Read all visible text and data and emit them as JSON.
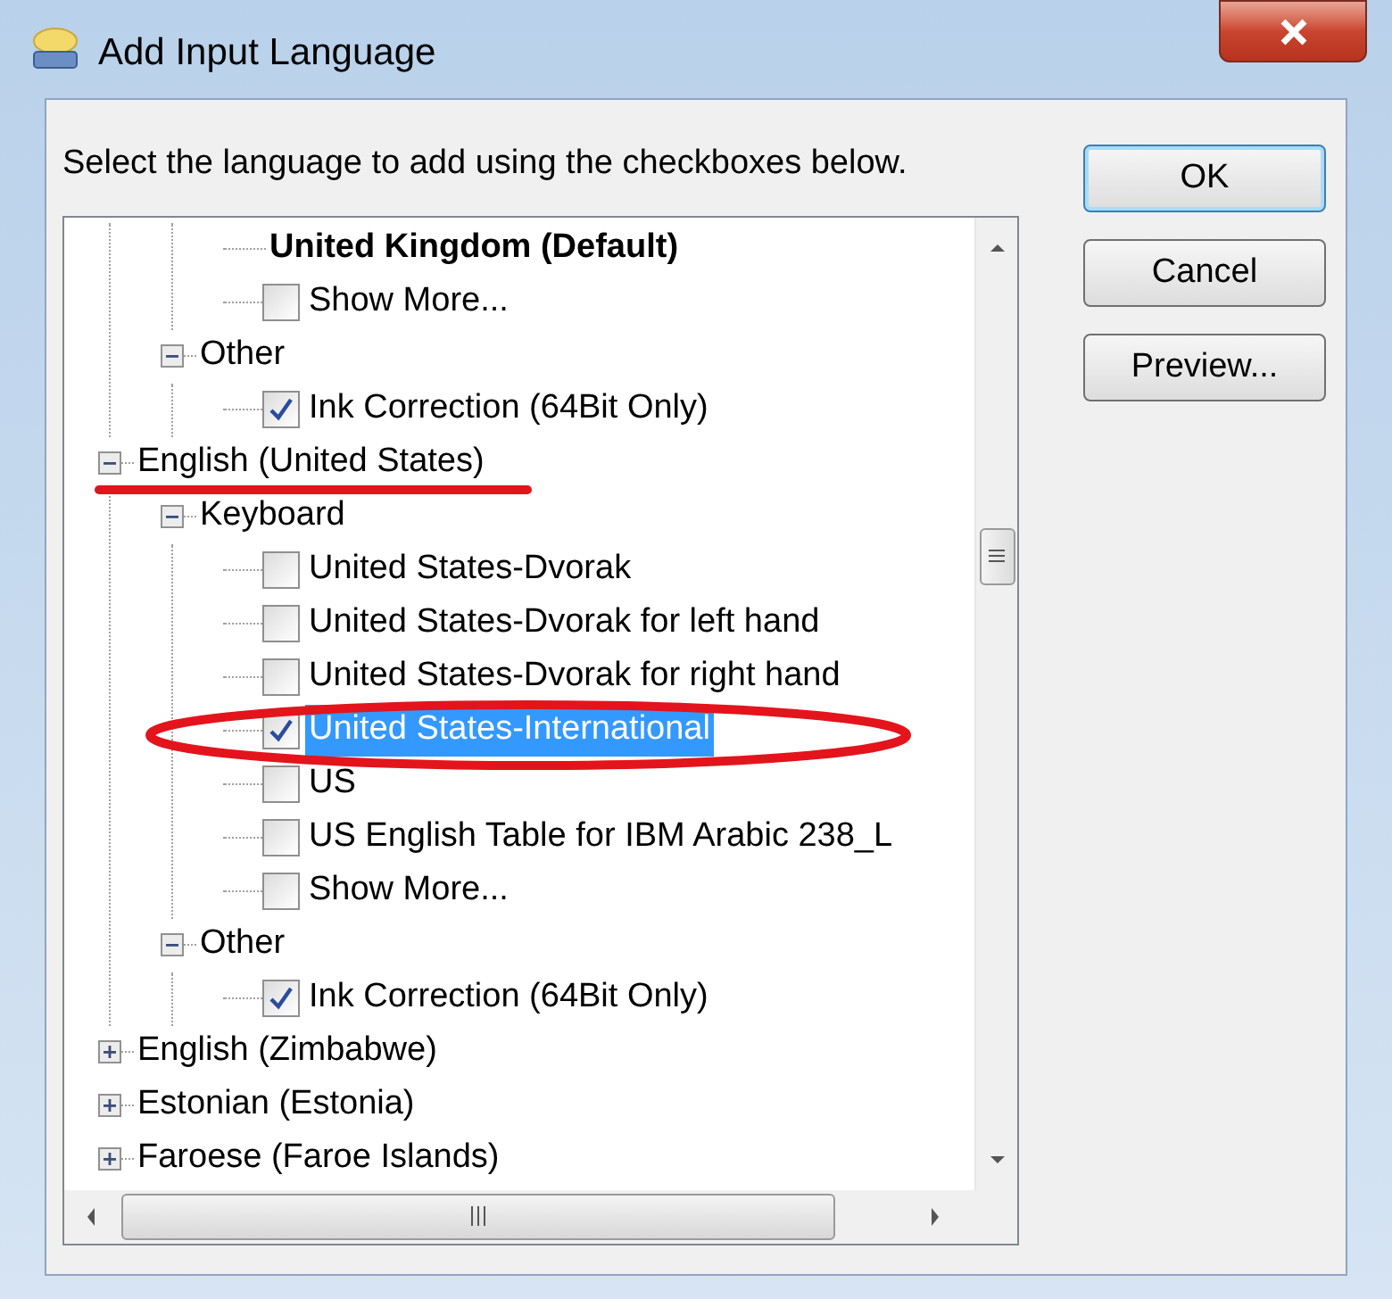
{
  "window": {
    "title": "Add Input Language"
  },
  "instruction": "Select the language to add using the checkboxes below.",
  "tree": [
    {
      "kind": "offscreen",
      "children": [
        {
          "kind": "offscreen",
          "children": [
            {
              "kind": "default",
              "label": "United Kingdom (Default)"
            },
            {
              "kind": "checkbox",
              "label": "Show More...",
              "checked": false,
              "selected": false
            }
          ]
        },
        {
          "kind": "group",
          "label": "Other",
          "expanded": true,
          "children": [
            {
              "kind": "checkbox",
              "label": "Ink Correction (64Bit Only)",
              "checked": true,
              "selected": false
            }
          ]
        }
      ]
    },
    {
      "kind": "group",
      "label": "English (United States)",
      "expanded": true,
      "children": [
        {
          "kind": "group",
          "label": "Keyboard",
          "expanded": true,
          "children": [
            {
              "kind": "checkbox",
              "label": "United States-Dvorak",
              "checked": false,
              "selected": false
            },
            {
              "kind": "checkbox",
              "label": "United States-Dvorak for left hand",
              "checked": false,
              "selected": false
            },
            {
              "kind": "checkbox",
              "label": "United States-Dvorak for right hand",
              "checked": false,
              "selected": false
            },
            {
              "kind": "checkbox",
              "label": "United States-International",
              "checked": true,
              "selected": true
            },
            {
              "kind": "checkbox",
              "label": "US",
              "checked": false,
              "selected": false
            },
            {
              "kind": "checkbox",
              "label": "US English Table for IBM Arabic 238_L",
              "checked": false,
              "selected": false
            },
            {
              "kind": "checkbox",
              "label": "Show More...",
              "checked": false,
              "selected": false
            }
          ]
        },
        {
          "kind": "group",
          "label": "Other",
          "expanded": true,
          "children": [
            {
              "kind": "checkbox",
              "label": "Ink Correction (64Bit Only)",
              "checked": true,
              "selected": false
            }
          ]
        }
      ]
    },
    {
      "kind": "group",
      "label": "English (Zimbabwe)",
      "expanded": false
    },
    {
      "kind": "group",
      "label": "Estonian (Estonia)",
      "expanded": false
    },
    {
      "kind": "group",
      "label": "Faroese (Faroe Islands)",
      "expanded": false
    }
  ],
  "buttons": [
    {
      "label": "OK",
      "default": true
    },
    {
      "label": "Cancel",
      "default": false
    },
    {
      "label": "Preview...",
      "default": false
    }
  ]
}
